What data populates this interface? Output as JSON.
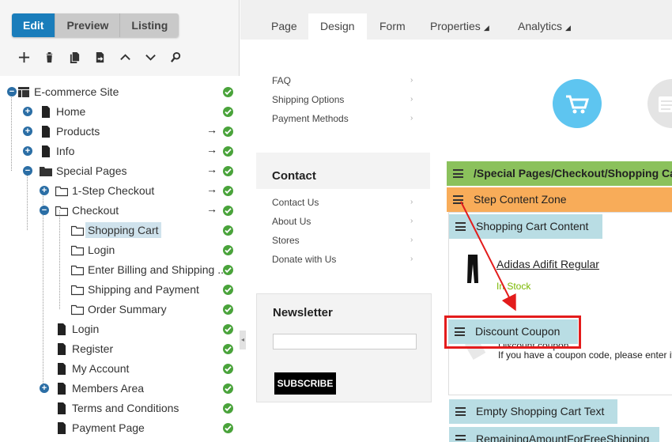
{
  "mode_tabs": [
    "Edit",
    "Preview",
    "Listing"
  ],
  "toolbar": [
    "add-icon",
    "delete-icon",
    "copy-icon",
    "move-icon",
    "up-icon",
    "down-icon",
    "search-icon"
  ],
  "tree": [
    {
      "label": "E-commerce Site",
      "level": 0,
      "expander": "minus",
      "icon": "site"
    },
    {
      "label": "Home",
      "level": 1,
      "expander": "plus",
      "icon": "page"
    },
    {
      "label": "Products",
      "level": 1,
      "expander": "plus",
      "icon": "page",
      "arrow": "→"
    },
    {
      "label": "Info",
      "level": 1,
      "expander": "plus",
      "icon": "page",
      "arrow": "→"
    },
    {
      "label": "Special Pages",
      "level": 1,
      "expander": "minus",
      "icon": "folder",
      "arrow": "→"
    },
    {
      "label": "1-Step Checkout",
      "level": 2,
      "expander": "plus",
      "icon": "folder-open",
      "arrow": "→"
    },
    {
      "label": "Checkout",
      "level": 2,
      "expander": "minus",
      "icon": "folder-open",
      "arrow": "→"
    },
    {
      "label": "Shopping Cart",
      "level": 3,
      "icon": "folder-open",
      "selected": true
    },
    {
      "label": "Login",
      "level": 3,
      "icon": "folder-open"
    },
    {
      "label": "Enter Billing and Shipping ...",
      "level": 3,
      "icon": "folder-open"
    },
    {
      "label": "Shipping and Payment",
      "level": 3,
      "icon": "folder-open"
    },
    {
      "label": "Order Summary",
      "level": 3,
      "icon": "folder-open"
    },
    {
      "label": "Login",
      "level": 2,
      "icon": "page"
    },
    {
      "label": "Register",
      "level": 2,
      "icon": "page"
    },
    {
      "label": "My Account",
      "level": 2,
      "icon": "page"
    },
    {
      "label": "Members Area",
      "level": 2,
      "expander": "plus",
      "icon": "page"
    },
    {
      "label": "Terms and Conditions",
      "level": 2,
      "icon": "page"
    },
    {
      "label": "Payment Page",
      "level": 2,
      "icon": "page"
    }
  ],
  "page_tabs": [
    {
      "label": "Page"
    },
    {
      "label": "Design",
      "active": true
    },
    {
      "label": "Form"
    },
    {
      "label": "Properties",
      "dropdown": true
    },
    {
      "label": "Analytics",
      "dropdown": true
    }
  ],
  "design": {
    "top_links": [
      "FAQ",
      "Shipping Options",
      "Payment Methods"
    ],
    "contact": {
      "title": "Contact",
      "links": [
        "Contact Us",
        "About Us",
        "Stores",
        "Donate with Us"
      ]
    },
    "newsletter": {
      "title": "Newsletter",
      "button": "SUBSCRIBE"
    },
    "path_bar": "/Special Pages/Checkout/Shopping Ca",
    "step_zone": "Step Content Zone",
    "cart_content": "Shopping Cart Content",
    "product_name": "Adidas Adifit Regular",
    "product_status": "In Stock",
    "discount_coupon": "Discount Coupon",
    "coupon_title": "Discount coupon",
    "coupon_text": "If you have a coupon code, please enter it",
    "empty_cart": "Empty Shopping Cart Text",
    "remaining": "RemainingAmountForFreeShipping"
  },
  "colors": {
    "accent": "#1a7dbb",
    "ok": "#4aa33b",
    "path_bar": "#8bc15c",
    "step_zone": "#f8ac59",
    "webpart": "#b9dde4",
    "highlight": "#e31c1c"
  }
}
